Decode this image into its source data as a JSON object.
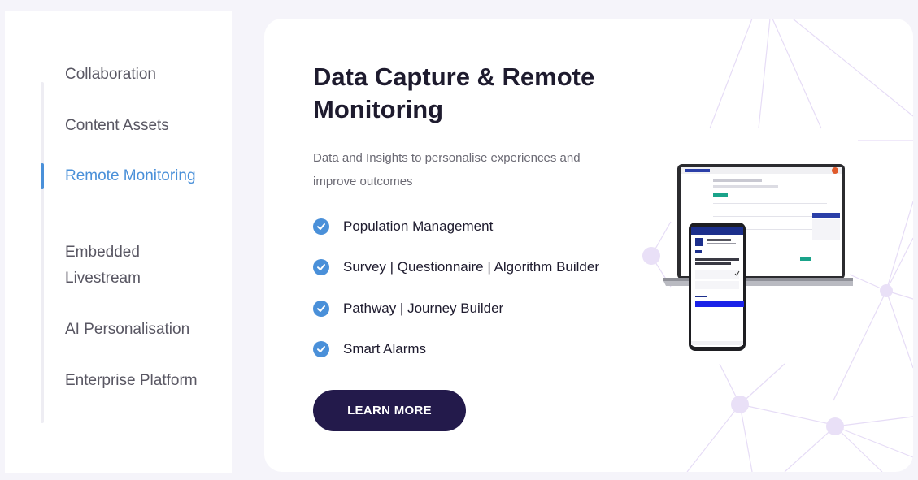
{
  "sidebar": {
    "items": [
      {
        "label": "Collaboration",
        "active": false
      },
      {
        "label": "Content Assets",
        "active": false
      },
      {
        "label": "Remote Monitoring",
        "active": true
      },
      {
        "label": "Embedded Livestream",
        "active": false
      },
      {
        "label": "AI Personalisation",
        "active": false
      },
      {
        "label": "Enterprise Platform",
        "active": false
      }
    ]
  },
  "main": {
    "title": "Data Capture & Remote Monitoring",
    "subtitle": "Data and Insights to personalise experiences and improve outcomes",
    "features": [
      "Population Management",
      "Survey | Questionnaire | Algorithm Builder",
      "Pathway | Journey Builder",
      "Smart Alarms"
    ],
    "cta_label": "LEARN MORE",
    "illustration_icons": [
      "laptop-icon",
      "smartphone-icon"
    ]
  },
  "colors": {
    "accent": "#4a90d9",
    "button": "#231a4b",
    "network_lines": "#e6dcf6",
    "text_dark": "#1e1b2e"
  }
}
